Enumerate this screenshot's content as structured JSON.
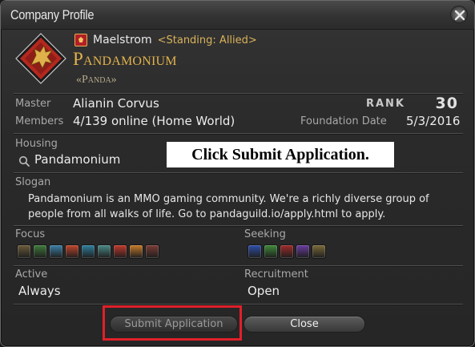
{
  "window": {
    "title": "Company Profile"
  },
  "company": {
    "grand_company": "Maelstrom",
    "standing": "<Standing: Allied>",
    "name": "Pandamonium",
    "tag": "«Panda»"
  },
  "info": {
    "master_label": "Master",
    "master_value": "Alianin Corvus",
    "rank_label": "RANK",
    "rank_value": "30",
    "members_label": "Members",
    "members_value": "4/139 online (Home World)",
    "foundation_label": "Foundation Date",
    "foundation_value": "5/3/2016",
    "housing_label": "Housing",
    "housing_value": "Pandamonium",
    "slogan_label": "Slogan",
    "slogan_text": "Pandamonium is an MMO gaming community. We're a richly diverse group of people from all walks of life. Go to pandaguild.io/apply.html to apply.",
    "focus_label": "Focus",
    "seeking_label": "Seeking",
    "active_label": "Active",
    "active_value": "Always",
    "recruitment_label": "Recruitment",
    "recruitment_value": "Open"
  },
  "overlay": {
    "instruction": "Click Submit Application."
  },
  "buttons": {
    "submit_label": "Submit Application",
    "close_label": "Close"
  },
  "focus_icons": [
    {
      "name": "role-playing-icon",
      "color": "#6a5a3a"
    },
    {
      "name": "leveling-icon",
      "color": "#3f7a3a"
    },
    {
      "name": "casual-icon",
      "color": "#3d7fa6"
    },
    {
      "name": "hardcore-icon",
      "color": "#c0452c"
    },
    {
      "name": "dungeons-icon",
      "color": "#2f7f9c"
    },
    {
      "name": "guildhests-icon",
      "color": "#4a8a86"
    },
    {
      "name": "trials-icon",
      "color": "#c0392b"
    },
    {
      "name": "raids-icon",
      "color": "#c77b2a"
    },
    {
      "name": "pvp-icon",
      "color": "#7a3b35"
    }
  ],
  "seeking_icons": [
    {
      "name": "tank-icon",
      "color": "#2f4fa8"
    },
    {
      "name": "healer-icon",
      "color": "#3f8a3a"
    },
    {
      "name": "dps-icon",
      "color": "#a02a2a"
    },
    {
      "name": "crafter-icon",
      "color": "#6a3ca0"
    },
    {
      "name": "gatherer-icon",
      "color": "#7a6a3a"
    }
  ]
}
